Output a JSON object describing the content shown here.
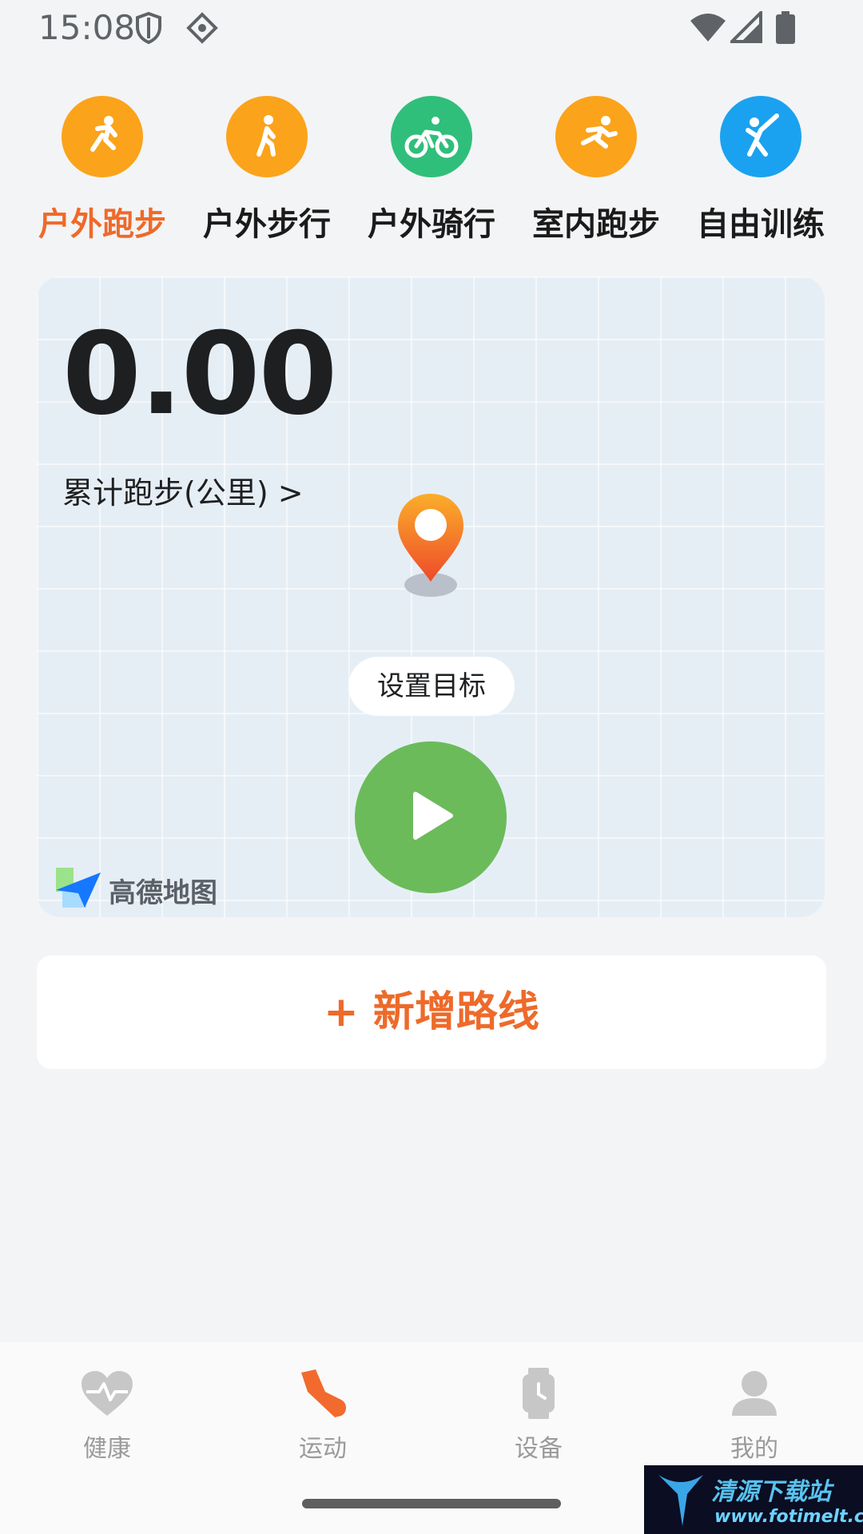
{
  "status_bar": {
    "time": "15:08",
    "icons": [
      "shield-icon",
      "vpn-icon",
      "wifi-icon",
      "signal-icon",
      "battery-icon"
    ]
  },
  "sport_tabs": [
    {
      "label": "户外跑步",
      "icon": "running-icon",
      "color": "#fba31a",
      "active": true
    },
    {
      "label": "户外步行",
      "icon": "walking-icon",
      "color": "#fba31a",
      "active": false
    },
    {
      "label": "户外骑行",
      "icon": "cycling-icon",
      "color": "#2fbf7a",
      "active": false
    },
    {
      "label": "室内跑步",
      "icon": "indoor-running-icon",
      "color": "#fba31a",
      "active": false
    },
    {
      "label": "自由训练",
      "icon": "free-training-icon",
      "color": "#1aa2f0",
      "active": false
    }
  ],
  "map_card": {
    "total_value": "0.00",
    "total_label": "累计跑步(公里) >",
    "goal_button": "设置目标",
    "start_icon": "play-icon",
    "map_logo": "高德地图"
  },
  "add_route": {
    "label": "+ 新增路线"
  },
  "bottom_nav": [
    {
      "label": "健康",
      "icon": "health-heart-icon",
      "active": false
    },
    {
      "label": "运动",
      "icon": "sport-shoe-icon",
      "active": true
    },
    {
      "label": "设备",
      "icon": "watch-icon",
      "active": false
    },
    {
      "label": "我的",
      "icon": "profile-icon",
      "active": false
    }
  ],
  "watermark": {
    "title": "清源下载站",
    "url": "www.fotimelt.com"
  },
  "colors": {
    "accent": "#ee6a2a",
    "start_button": "#6bbb5b",
    "background": "#f3f4f6"
  }
}
